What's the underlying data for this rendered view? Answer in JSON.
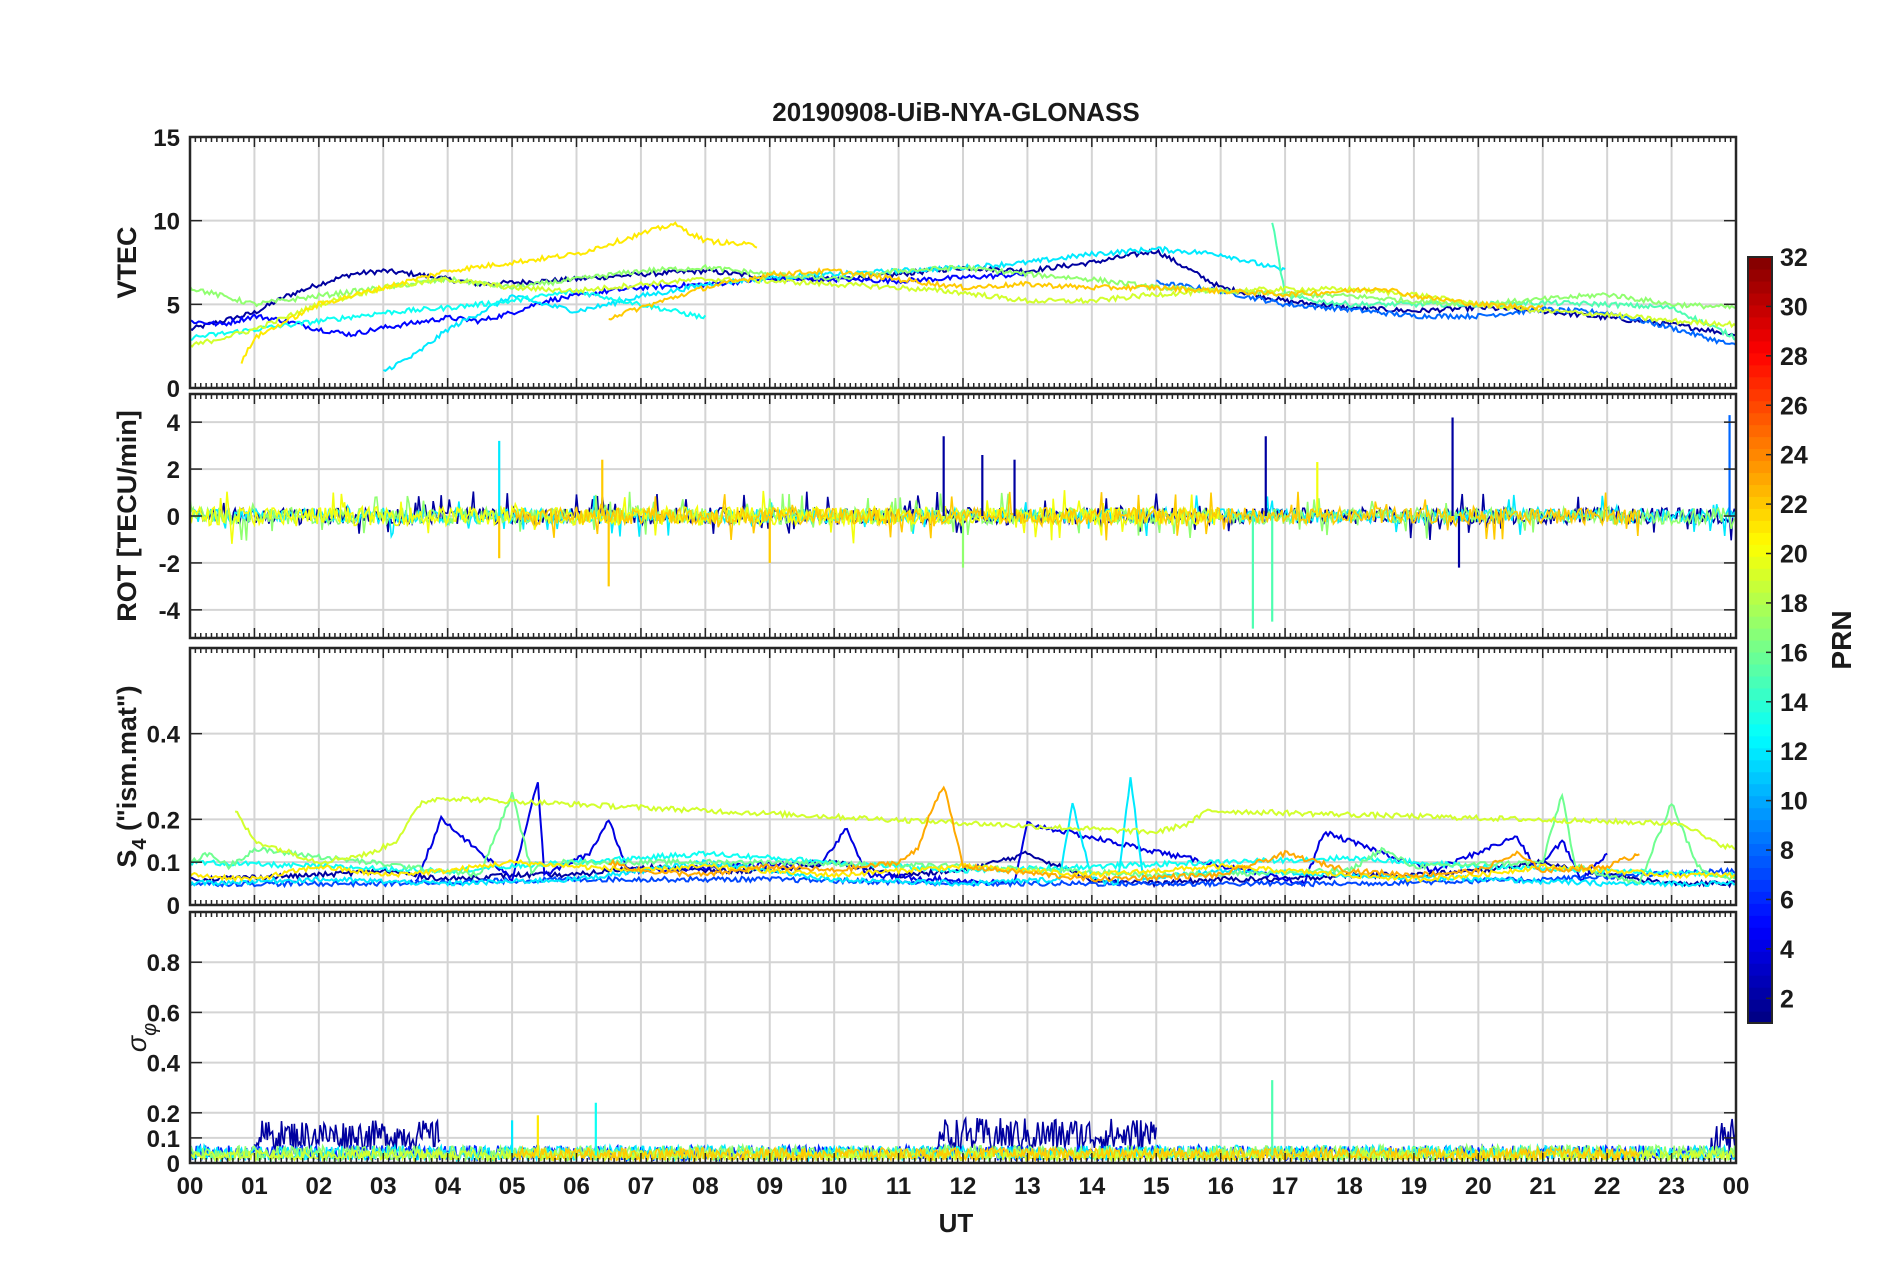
{
  "figure": {
    "title": "20190908-UiB-NYA-GLONASS",
    "xlabel": "UT"
  },
  "chart_data": [
    {
      "type": "line",
      "panel": "vtec",
      "ylabel": "VTEC",
      "ylim": [
        0,
        15
      ],
      "yticks": [
        0,
        5,
        10,
        15
      ],
      "xlim": [
        0,
        24
      ],
      "grid": true,
      "series": [
        {
          "prn": 2,
          "x": [
            0,
            0.5,
            1,
            1.5,
            2,
            2.5,
            3,
            3.5,
            4,
            4.5,
            5,
            6,
            7,
            8,
            9,
            10,
            11,
            12,
            13,
            14,
            15,
            16,
            17,
            18,
            19,
            20,
            21,
            22,
            23,
            24
          ],
          "y": [
            3.5,
            4.0,
            4.5,
            5.5,
            6.2,
            6.8,
            7.0,
            6.8,
            6.5,
            6.2,
            6.3,
            6.5,
            6.8,
            7.0,
            6.6,
            6.5,
            6.8,
            7.2,
            7.0,
            7.5,
            8.2,
            6.0,
            5.2,
            4.8,
            4.6,
            4.8,
            4.6,
            4.2,
            3.8,
            3.2
          ]
        },
        {
          "prn": 5,
          "x": [
            0,
            0.5,
            1,
            1.5,
            2,
            2.5,
            3,
            3.5,
            4,
            4.5,
            5,
            5.5,
            6,
            6.5,
            7,
            8,
            9,
            10,
            11,
            12,
            13
          ],
          "y": [
            4.0,
            3.8,
            4.3,
            4.0,
            3.5,
            3.2,
            3.6,
            3.9,
            4.2,
            4.0,
            4.5,
            5.2,
            5.5,
            5.8,
            6.0,
            6.2,
            6.5,
            6.5,
            6.4,
            6.6,
            6.8
          ]
        },
        {
          "prn": 8,
          "x": [
            15,
            16,
            17,
            18,
            19,
            20,
            21,
            22,
            23,
            24
          ],
          "y": [
            6.3,
            5.8,
            5.0,
            4.7,
            4.3,
            4.3,
            4.7,
            4.5,
            3.6,
            2.5
          ]
        },
        {
          "prn": 12,
          "x": [
            3,
            3.5,
            4,
            4.5,
            5,
            5.5,
            6,
            6.5,
            7,
            7.5,
            8,
            9,
            10,
            11,
            12,
            13,
            14,
            15,
            16,
            17
          ],
          "y": [
            1.0,
            2.0,
            3.5,
            4.5,
            5.5,
            5.0,
            4.6,
            5.0,
            5.5,
            5.8,
            6.2,
            6.6,
            6.8,
            7.0,
            7.2,
            7.5,
            8.0,
            8.3,
            8.0,
            7.0
          ]
        },
        {
          "prn": 13,
          "x": [
            0,
            1,
            2,
            3,
            4,
            5,
            6,
            7,
            8
          ],
          "y": [
            3.0,
            3.5,
            4.0,
            4.5,
            4.8,
            5.2,
            5.8,
            5.0,
            4.2
          ]
        },
        {
          "prn": 15,
          "x": [
            16.8,
            17,
            17.5,
            18,
            19,
            20,
            21,
            22,
            23,
            24
          ],
          "y": [
            10.0,
            5.5,
            5.2,
            5.0,
            5.0,
            5.0,
            5.1,
            5.0,
            4.8,
            3.0
          ]
        },
        {
          "prn": 17,
          "x": [
            0,
            0.5,
            1,
            2,
            3,
            4,
            5,
            6,
            7,
            8,
            9,
            10,
            11,
            12,
            13,
            14,
            15,
            16,
            17,
            18,
            19,
            20,
            21,
            22,
            23,
            24
          ],
          "y": [
            6.0,
            5.5,
            5.0,
            5.5,
            6.0,
            6.5,
            6.0,
            6.5,
            7.0,
            7.2,
            6.8,
            6.5,
            7.0,
            7.2,
            6.8,
            6.5,
            6.0,
            5.8,
            5.6,
            5.5,
            5.2,
            5.0,
            5.3,
            5.6,
            5.0,
            4.8
          ]
        },
        {
          "prn": 19,
          "x": [
            0,
            1,
            2,
            3,
            4,
            5,
            6,
            7,
            8,
            9,
            10,
            11,
            12,
            13,
            14,
            15,
            16,
            17,
            18,
            19,
            20,
            21,
            22,
            23,
            24
          ],
          "y": [
            2.5,
            3.5,
            5.0,
            6.0,
            6.5,
            6.0,
            5.8,
            6.2,
            6.5,
            6.4,
            6.2,
            6.0,
            5.7,
            5.2,
            5.2,
            5.6,
            5.8,
            5.9,
            5.9,
            5.6,
            5.0,
            4.6,
            4.4,
            4.0,
            3.8
          ]
        },
        {
          "prn": 21,
          "x": [
            0.8,
            1,
            2,
            3,
            4,
            5,
            6,
            7,
            7.5,
            8,
            8.8
          ],
          "y": [
            1.5,
            3.0,
            5.0,
            6.0,
            7.0,
            7.5,
            8.0,
            9.2,
            9.8,
            8.8,
            8.5
          ]
        },
        {
          "prn": 22,
          "x": [
            6.5,
            7,
            8,
            9,
            10,
            11,
            12,
            13,
            14,
            15,
            16,
            17,
            18,
            18.5,
            19,
            20,
            21
          ],
          "y": [
            4.2,
            4.8,
            6.0,
            6.8,
            7.0,
            6.5,
            6.0,
            6.2,
            6.0,
            6.0,
            5.8,
            5.6,
            5.8,
            6.0,
            5.5,
            5.0,
            4.8
          ]
        }
      ]
    },
    {
      "type": "line",
      "panel": "rot",
      "ylabel": "ROT [TECU/min]",
      "ylim": [
        -5.2,
        5.2
      ],
      "yticks": [
        -4,
        -2,
        0,
        2,
        4
      ],
      "xlim": [
        0,
        24
      ],
      "grid": true,
      "baseline_series": [
        {
          "prn": 2,
          "hours": [
            0,
            24
          ],
          "amplitude": 0.35
        },
        {
          "prn": 12,
          "hours": [
            0,
            24
          ],
          "amplitude": 0.3
        },
        {
          "prn": 17,
          "hours": [
            0,
            24
          ],
          "amplitude": 0.35
        },
        {
          "prn": 20,
          "hours": [
            0,
            16
          ],
          "amplitude": 0.4
        },
        {
          "prn": 22,
          "hours": [
            5,
            22.5
          ],
          "amplitude": 0.35
        }
      ],
      "spikes": [
        {
          "prn": 12,
          "x": 4.8,
          "y": 3.2
        },
        {
          "prn": 22,
          "x": 4.8,
          "y": -1.8
        },
        {
          "prn": 22,
          "x": 6.4,
          "y": 2.4
        },
        {
          "prn": 22,
          "x": 6.5,
          "y": -3.0
        },
        {
          "prn": 22,
          "x": 9.0,
          "y": -2.0
        },
        {
          "prn": 2,
          "x": 11.7,
          "y": 3.4
        },
        {
          "prn": 2,
          "x": 12.3,
          "y": 2.6
        },
        {
          "prn": 17,
          "x": 12.0,
          "y": -2.2
        },
        {
          "prn": 2,
          "x": 12.8,
          "y": 2.4
        },
        {
          "prn": 2,
          "x": 16.7,
          "y": 3.4
        },
        {
          "prn": 15,
          "x": 16.5,
          "y": -4.8
        },
        {
          "prn": 15,
          "x": 16.8,
          "y": -4.5
        },
        {
          "prn": 20,
          "x": 17.5,
          "y": 2.3
        },
        {
          "prn": 2,
          "x": 19.6,
          "y": 4.2
        },
        {
          "prn": 2,
          "x": 19.7,
          "y": -2.2
        },
        {
          "prn": 8,
          "x": 23.9,
          "y": 4.3
        }
      ]
    },
    {
      "type": "line",
      "panel": "s4",
      "ylabel": "S4 (\"ism.mat\")",
      "ylabel_main": "S",
      "ylabel_sub": "4",
      "ylabel_rest": " (\"ism.mat\")",
      "ylim": [
        0,
        0.6
      ],
      "yticks": [
        0,
        0.1,
        0.2,
        0.4
      ],
      "xlim": [
        0,
        24
      ],
      "grid": true,
      "series": [
        {
          "prn": 2,
          "x": [
            0,
            2,
            3,
            4,
            5,
            6,
            7,
            8,
            9,
            10,
            11,
            12,
            13,
            14,
            15,
            16,
            17,
            18,
            19,
            20,
            21,
            22,
            23,
            24
          ],
          "y": [
            0.06,
            0.07,
            0.08,
            0.06,
            0.07,
            0.07,
            0.09,
            0.08,
            0.08,
            0.1,
            0.07,
            0.08,
            0.12,
            0.06,
            0.05,
            0.06,
            0.06,
            0.07,
            0.07,
            0.08,
            0.1,
            0.07,
            0.05,
            0.05
          ]
        },
        {
          "prn": 4,
          "x": [
            3.5,
            3.9,
            5.0,
            5.4,
            5.5,
            6.2,
            6.5,
            6.8,
            9.8,
            10.2,
            10.5,
            12.8,
            13.0,
            17.3,
            17.6,
            19.3,
            20.6,
            20.9,
            21.3,
            21.6,
            22.0
          ],
          "y": [
            0.05,
            0.2,
            0.06,
            0.29,
            0.07,
            0.12,
            0.2,
            0.08,
            0.1,
            0.18,
            0.07,
            0.05,
            0.19,
            0.05,
            0.17,
            0.08,
            0.16,
            0.08,
            0.15,
            0.06,
            0.12
          ]
        },
        {
          "prn": 7,
          "x": [
            0,
            3,
            6,
            9,
            12,
            15,
            18,
            21,
            24
          ],
          "y": [
            0.05,
            0.05,
            0.06,
            0.06,
            0.05,
            0.05,
            0.05,
            0.06,
            0.08
          ]
        },
        {
          "prn": 12,
          "x": [
            0,
            2,
            4,
            6,
            8,
            10,
            12,
            13.5,
            13.7,
            14.0,
            14.4,
            14.6,
            14.8,
            16,
            18,
            20,
            22,
            24
          ],
          "y": [
            0.05,
            0.06,
            0.05,
            0.06,
            0.1,
            0.06,
            0.05,
            0.06,
            0.24,
            0.06,
            0.05,
            0.3,
            0.06,
            0.08,
            0.07,
            0.06,
            0.05,
            0.05
          ]
        },
        {
          "prn": 13,
          "x": [
            0,
            2,
            4,
            6,
            8,
            10,
            12,
            14,
            16,
            18,
            20,
            22,
            24
          ],
          "y": [
            0.1,
            0.09,
            0.08,
            0.1,
            0.12,
            0.1,
            0.08,
            0.09,
            0.1,
            0.11,
            0.09,
            0.08,
            0.07
          ]
        },
        {
          "prn": 16,
          "x": [
            0,
            0.3,
            0.6,
            1,
            4.5,
            5.0,
            5.3,
            5.6,
            9,
            12,
            15,
            18,
            18.5,
            19,
            21.0,
            21.3,
            21.5,
            22.5,
            23,
            23.4,
            23.7,
            24
          ],
          "y": [
            0.1,
            0.12,
            0.09,
            0.13,
            0.07,
            0.26,
            0.08,
            0.1,
            0.1,
            0.09,
            0.07,
            0.08,
            0.13,
            0.09,
            0.1,
            0.26,
            0.09,
            0.05,
            0.24,
            0.09,
            0.07,
            0.06
          ]
        },
        {
          "prn": 19,
          "x": [
            0.7,
            1,
            2,
            2.8,
            3.2,
            3.6,
            3.9,
            15.0,
            15.5,
            15.8,
            23.2,
            23.6,
            24
          ],
          "y": [
            0.22,
            0.15,
            0.1,
            0.12,
            0.15,
            0.24,
            0.25,
            0.17,
            0.19,
            0.22,
            0.19,
            0.15,
            0.13
          ]
        },
        {
          "prn": 21,
          "x": [
            0,
            1,
            2,
            3,
            4,
            5,
            6,
            7,
            8,
            9,
            10,
            11,
            12,
            13,
            14,
            15,
            16,
            17,
            18,
            19,
            20,
            21,
            22,
            23,
            24
          ],
          "y": [
            0.07,
            0.06,
            0.09,
            0.07,
            0.08,
            0.1,
            0.09,
            0.08,
            0.09,
            0.08,
            0.07,
            0.08,
            0.09,
            0.08,
            0.07,
            0.08,
            0.09,
            0.08,
            0.07,
            0.06,
            0.07,
            0.09,
            0.08,
            0.07,
            0.07
          ]
        },
        {
          "prn": 23,
          "x": [
            6.5,
            7,
            8,
            9,
            10,
            11,
            11.3,
            11.5,
            11.7,
            12,
            14,
            16,
            17,
            18,
            19,
            20,
            20.6,
            21,
            22,
            22.5
          ],
          "y": [
            0.1,
            0.08,
            0.07,
            0.09,
            0.08,
            0.1,
            0.13,
            0.22,
            0.28,
            0.09,
            0.06,
            0.07,
            0.12,
            0.08,
            0.07,
            0.08,
            0.12,
            0.08,
            0.09,
            0.12
          ]
        }
      ]
    },
    {
      "type": "line",
      "panel": "sigma_phi",
      "ylabel": "σφ",
      "ylabel_main": "σ",
      "ylabel_sub": "φ",
      "ylim": [
        0,
        1.0
      ],
      "yticks": [
        0,
        0.1,
        0.2,
        0.4,
        0.6,
        0.8
      ],
      "xlim": [
        0,
        24
      ],
      "grid": true,
      "noise_series": [
        {
          "prn": 2,
          "hours": [
            1,
            3.9
          ],
          "level": 0.11,
          "amplitude": 0.06
        },
        {
          "prn": 2,
          "hours": [
            11.6,
            15.0
          ],
          "level": 0.11,
          "amplitude": 0.07
        },
        {
          "prn": 2,
          "hours": [
            23.6,
            24
          ],
          "level": 0.1,
          "amplitude": 0.08
        },
        {
          "prn": 6,
          "hours": [
            0,
            24
          ],
          "level": 0.04,
          "amplitude": 0.03
        },
        {
          "prn": 12,
          "hours": [
            0,
            24
          ],
          "level": 0.04,
          "amplitude": 0.03
        },
        {
          "prn": 17,
          "hours": [
            0,
            24
          ],
          "level": 0.04,
          "amplitude": 0.03
        },
        {
          "prn": 19,
          "hours": [
            0,
            24
          ],
          "level": 0.03,
          "amplitude": 0.02
        },
        {
          "prn": 22,
          "hours": [
            5,
            22.5
          ],
          "level": 0.035,
          "amplitude": 0.025
        }
      ],
      "spikes": [
        {
          "prn": 13,
          "x": 6.3,
          "y": 0.24
        },
        {
          "prn": 15,
          "x": 16.8,
          "y": 0.33
        },
        {
          "prn": 21,
          "x": 5.4,
          "y": 0.19
        },
        {
          "prn": 12,
          "x": 5.0,
          "y": 0.17
        }
      ]
    }
  ],
  "colorbar": {
    "label": "PRN",
    "range": [
      1,
      32
    ],
    "ticks": [
      2,
      4,
      6,
      8,
      10,
      12,
      14,
      16,
      18,
      20,
      22,
      24,
      26,
      28,
      30,
      32
    ],
    "colormap": "jet"
  },
  "xaxis": {
    "ticks": [
      "00",
      "01",
      "02",
      "03",
      "04",
      "05",
      "06",
      "07",
      "08",
      "09",
      "10",
      "11",
      "12",
      "13",
      "14",
      "15",
      "16",
      "17",
      "18",
      "19",
      "20",
      "21",
      "22",
      "23",
      "00"
    ]
  }
}
